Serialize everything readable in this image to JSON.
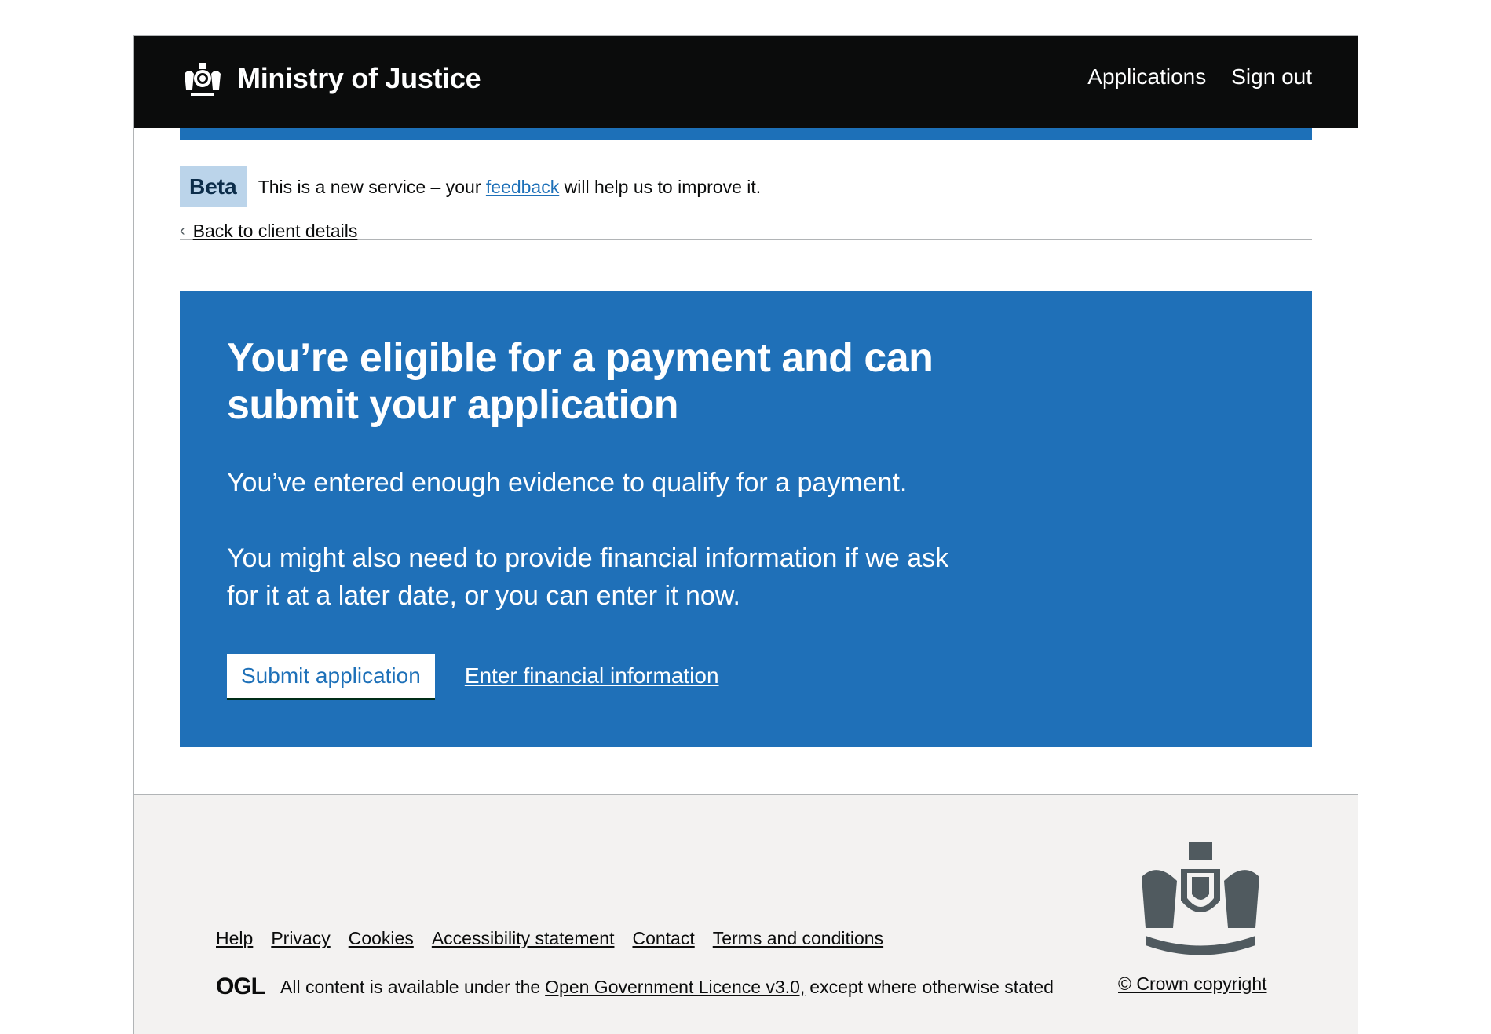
{
  "header": {
    "title": "Ministry of Justice",
    "nav": [
      "Applications",
      "Sign out"
    ]
  },
  "phase_banner": {
    "tag": "Beta",
    "text_before": "This is a new service – your",
    "link": "feedback",
    "text_after": "will help us to improve it."
  },
  "back_link": "Back to client details",
  "panel": {
    "title": "You’re eligible for a payment and can submit your application",
    "paragraph1": "You’ve entered enough evidence to qualify for a payment.",
    "paragraph2": "You might also need to provide financial information if we ask for it at a later date, or you can enter it now.",
    "submit_label": "Submit application",
    "financial_link": "Enter financial information"
  },
  "footer": {
    "links": [
      "Help",
      "Privacy",
      "Cookies",
      "Accessibility statement",
      "Contact",
      "Terms and conditions"
    ],
    "ogl_logo": "OGL",
    "licence_before": "All content is available under the",
    "licence_link": "Open Government Licence v3.0,",
    "licence_after": "except where otherwise stated",
    "copyright": "© Crown copyright"
  },
  "colors": {
    "header_bg": "#0b0c0c",
    "brand_blue": "#1d70b8",
    "footer_bg": "#f3f2f1"
  }
}
